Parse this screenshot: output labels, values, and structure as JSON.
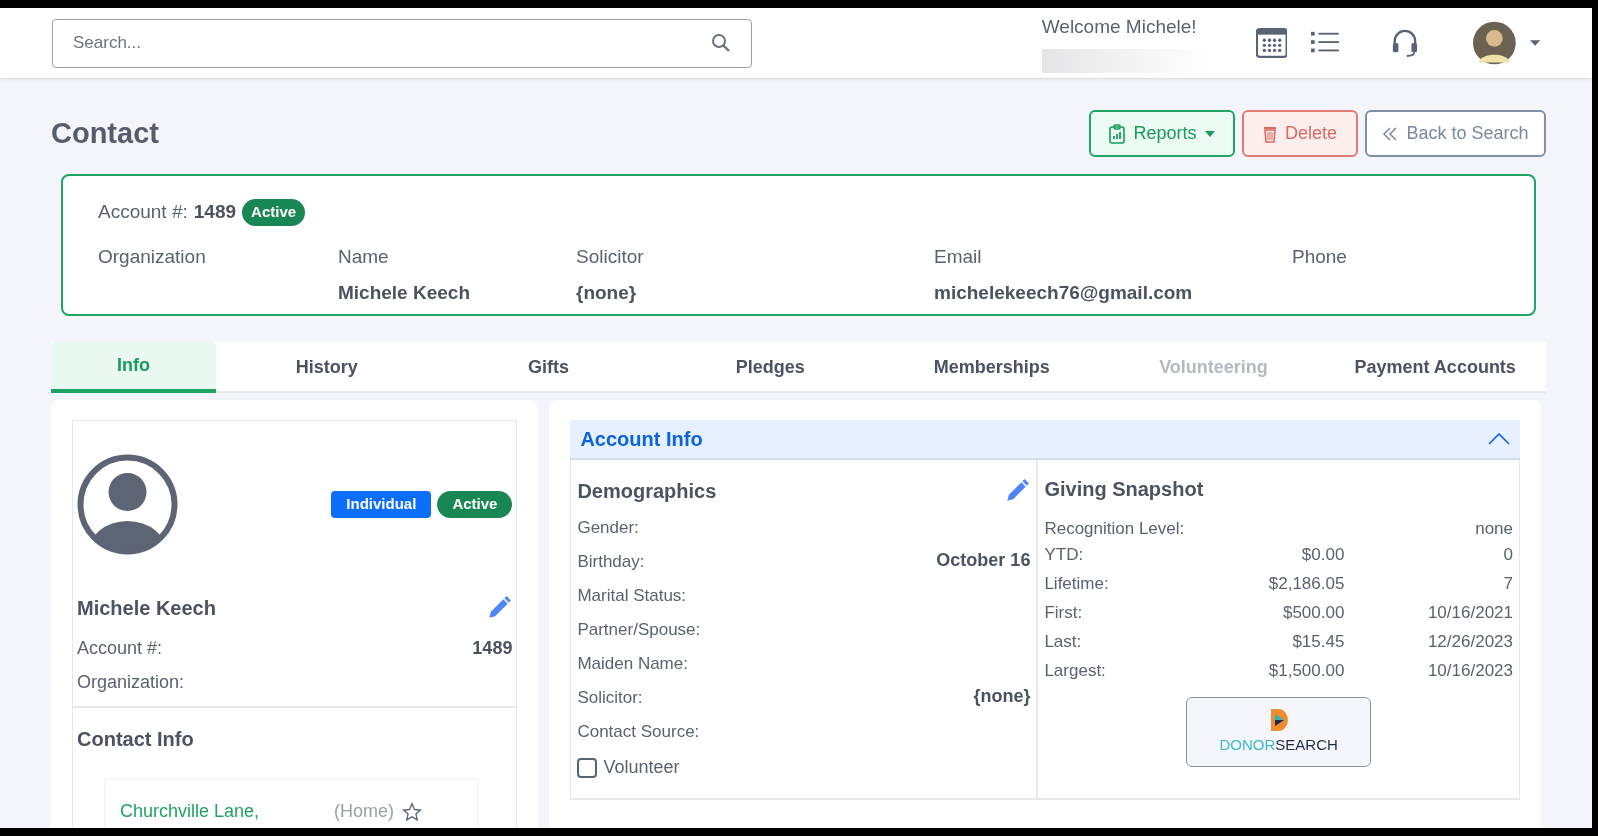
{
  "header": {
    "search": {
      "placeholder": "Search..."
    },
    "welcome": "Welcome Michele!"
  },
  "page": {
    "title": "Contact",
    "buttons": [
      {
        "kind": "reports",
        "label": "Reports"
      },
      {
        "kind": "delete",
        "label": "Delete"
      },
      {
        "kind": "back",
        "label": "Back to Search"
      }
    ]
  },
  "account_card": {
    "account_label": "Account #:",
    "account_number": "1489",
    "status": "Active",
    "fields": [
      {
        "label": "Organization"
      },
      {
        "label": "Name",
        "value": "Michele Keech"
      },
      {
        "label": "Solicitor",
        "value": "{none}"
      },
      {
        "label": "Email",
        "value": "michelekeech76@gmail.com"
      },
      {
        "label": "Phone"
      }
    ]
  },
  "tabs": [
    {
      "label": "Info",
      "selected": true,
      "disabled": false
    },
    {
      "label": "History",
      "selected": false,
      "disabled": false
    },
    {
      "label": "Gifts",
      "selected": false,
      "disabled": false
    },
    {
      "label": "Pledges",
      "selected": false,
      "disabled": false
    },
    {
      "label": "Memberships",
      "selected": false,
      "disabled": false
    },
    {
      "label": "Volunteering",
      "selected": false,
      "disabled": true
    },
    {
      "label": "Payment Accounts",
      "selected": false,
      "disabled": false
    }
  ],
  "profile": {
    "badges": [
      {
        "label": "Individual",
        "color": "#0d6efd"
      },
      {
        "label": "Active",
        "color": "#198754"
      }
    ],
    "name": "Michele Keech",
    "rows": [
      {
        "label": "Account #:",
        "value": "1489"
      },
      {
        "label": "Organization:"
      }
    ],
    "contact_info": {
      "title": "Contact Info",
      "address_line": "Churchville Lane,",
      "address_type": "(Home)"
    }
  },
  "account_info": {
    "title": "Account Info",
    "expanded": true,
    "demographics": {
      "title": "Demographics",
      "rows": [
        {
          "label": "Gender:"
        },
        {
          "label": "Birthday:",
          "value": "October 16"
        },
        {
          "label": "Marital Status:"
        },
        {
          "label": "Partner/Spouse:"
        },
        {
          "label": "Maiden Name:"
        },
        {
          "label": "Solicitor:",
          "value": "{none}"
        },
        {
          "label": "Contact Source:"
        }
      ],
      "volunteer": {
        "label": "Volunteer",
        "checked": false
      }
    },
    "giving": {
      "title": "Giving Snapshot",
      "recognition": {
        "label": "Recognition Level:",
        "value": "none"
      },
      "rows": [
        {
          "label": "YTD:",
          "amount": "$0.00",
          "extra": "0"
        },
        {
          "label": "Lifetime:",
          "amount": "$2,186.05",
          "extra": "7"
        },
        {
          "label": "First:",
          "amount": "$500.00",
          "extra": "10/16/2021"
        },
        {
          "label": "Last:",
          "amount": "$15.45",
          "extra": "12/26/2023"
        },
        {
          "label": "Largest:",
          "amount": "$1,500.00",
          "extra": "10/16/2023"
        }
      ],
      "logo": {
        "part_1": "DONOR",
        "part_2": "SEARCH"
      }
    }
  }
}
